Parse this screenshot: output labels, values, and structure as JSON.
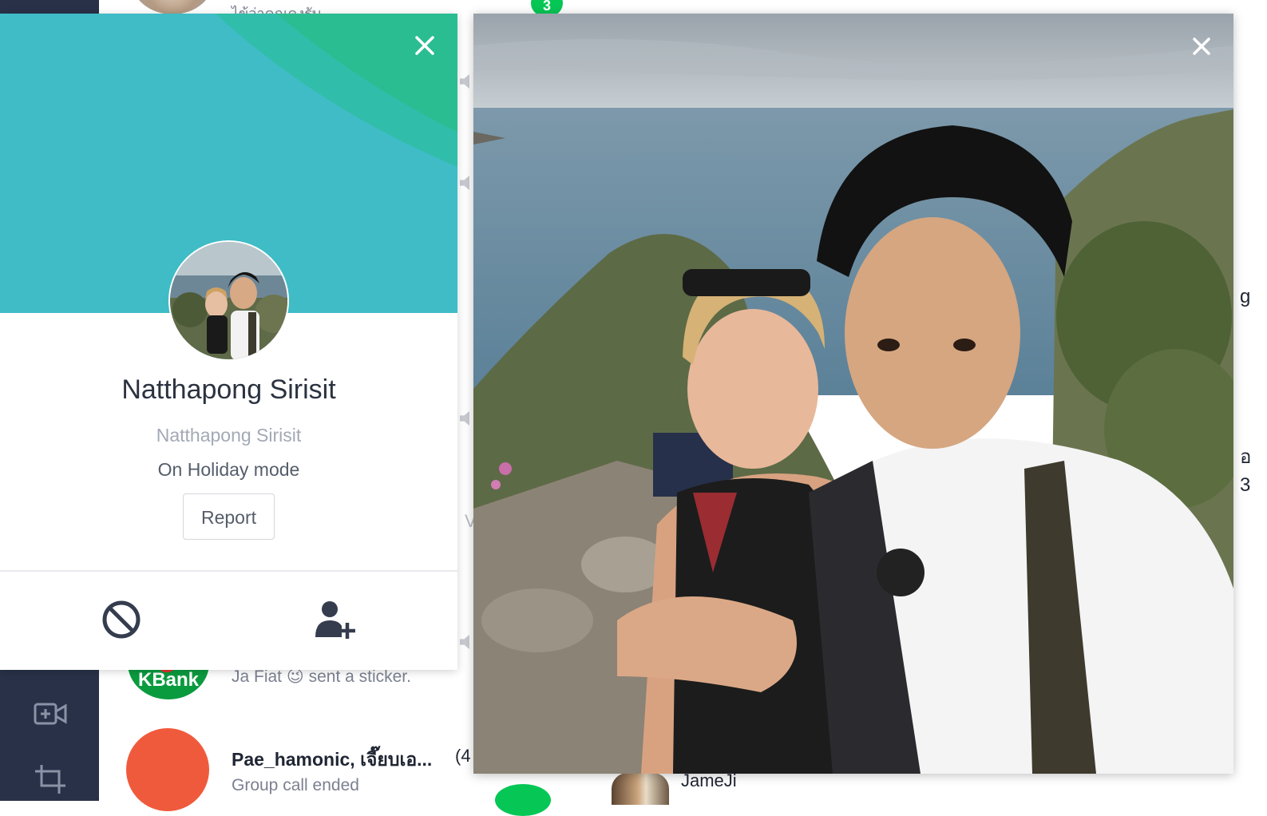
{
  "background": {
    "chat_list": {
      "top_row_preview": "ไข้ว่าคุณคงรับ",
      "top_unread": "3",
      "kbank_row": {
        "avatar_text": "KBank",
        "preview": "Ja Fiat 😉 sent a sticker."
      },
      "group_row": {
        "title": "Pae_hamonic, เจี๊ยบเอ...",
        "member_count": "(4",
        "preview": "Group call ended"
      }
    },
    "right_pane": {
      "sender_name": "JameJi",
      "edge_chars": [
        "g",
        "อ",
        "3"
      ],
      "list_edge_char": "V"
    }
  },
  "profile": {
    "display_name": "Natthapong Sirisit",
    "sub_name": "Natthapong Sirisit",
    "status_message": "On Holiday mode",
    "report_label": "Report",
    "actions": [
      {
        "icon": "block-icon"
      },
      {
        "icon": "add-friend-icon"
      }
    ],
    "cover_colors": {
      "base": "#3fbcc6",
      "mid": "#30bdaa",
      "top": "#2bbd92"
    }
  },
  "photo_viewer": {
    "close_icon": "close-icon"
  }
}
